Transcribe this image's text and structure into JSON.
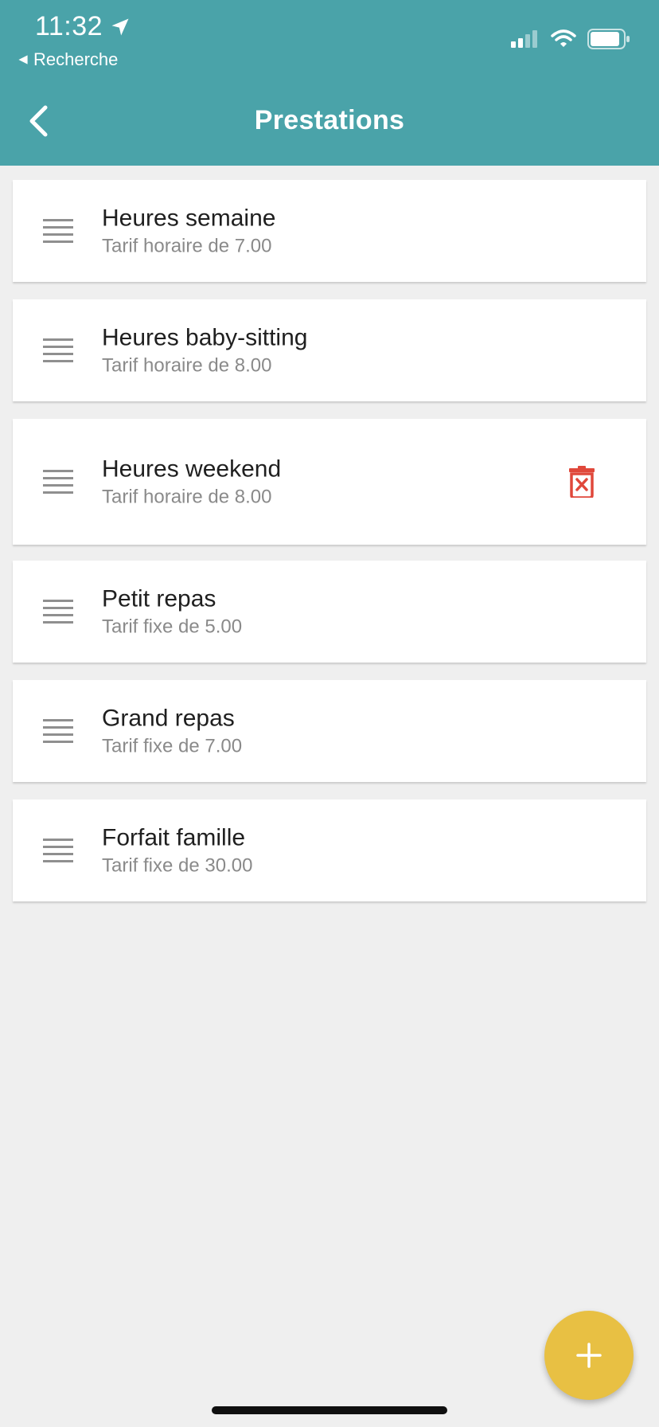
{
  "status_bar": {
    "time": "11:32",
    "back_app_label": "Recherche"
  },
  "header": {
    "title": "Prestations"
  },
  "items": [
    {
      "title": "Heures semaine",
      "subtitle": "Tarif horaire de 7.00"
    },
    {
      "title": "Heures baby-sitting",
      "subtitle": "Tarif horaire de 8.00"
    },
    {
      "title": "Heures weekend",
      "subtitle": "Tarif horaire de 8.00"
    },
    {
      "title": "Petit repas",
      "subtitle": "Tarif fixe de 5.00"
    },
    {
      "title": "Grand repas",
      "subtitle": "Tarif fixe de 7.00"
    },
    {
      "title": "Forfait famille",
      "subtitle": "Tarif fixe de 30.00"
    }
  ],
  "icons": {
    "back": "chevron-left-icon",
    "drag": "drag-handle-icon",
    "delete": "delete-icon",
    "add": "plus-icon"
  },
  "colors": {
    "header": "#4aa3a9",
    "background": "#efefef",
    "delete": "#e0483b",
    "fab": "#e8c043"
  }
}
